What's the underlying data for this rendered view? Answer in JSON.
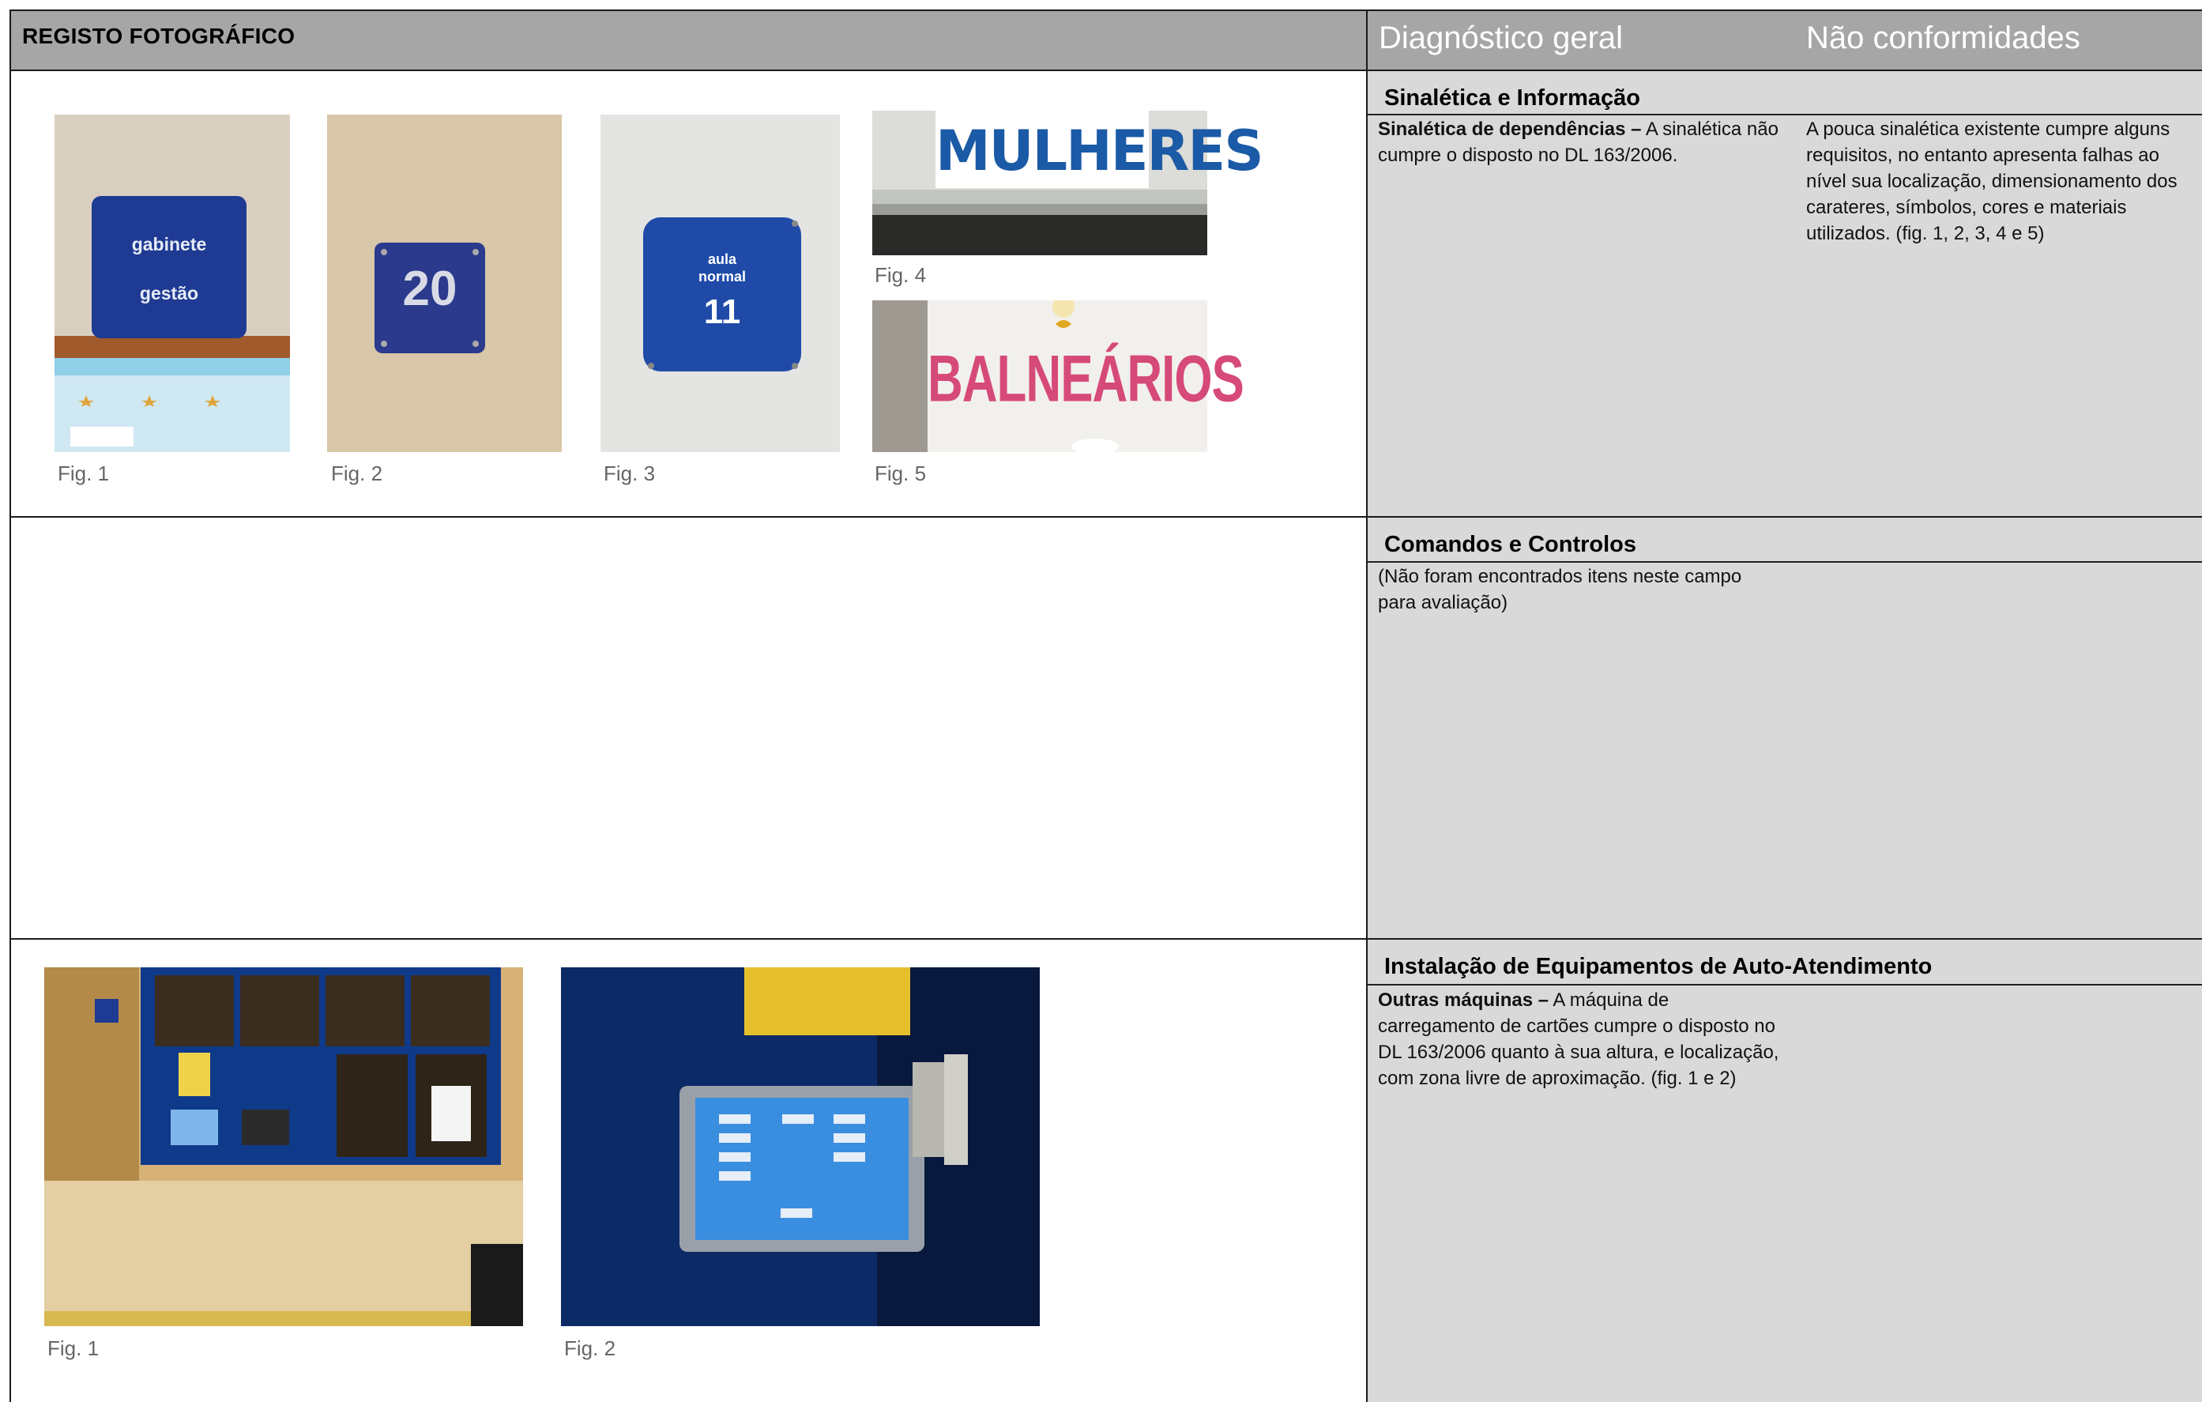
{
  "header": {
    "title": "REGISTO FOTOGRÁFICO",
    "col_diagnostico": "Diagnóstico geral",
    "col_nao_conformidades": "Não conformidades"
  },
  "sections": [
    {
      "title": "Sinalética e Informação",
      "diagnostico_bold": "Sinalética de dependências –",
      "diagnostico_text": " A sinalética não cumpre o disposto no DL 163/2006.",
      "nao_conformidades": "A pouca sinalética existente cumpre alguns requisitos, no entanto apresenta falhas ao nível sua localização, dimensionamento dos carateres, símbolos, cores e materiais utilizados. (fig. 1, 2, 3, 4 e 5)",
      "figures": [
        {
          "caption": "Fig. 1",
          "sign_line1": "gabinete",
          "sign_line2": "gestão"
        },
        {
          "caption": "Fig. 2",
          "sign_number": "20"
        },
        {
          "caption": "Fig. 3",
          "sign_line1": "aula",
          "sign_line2": "normal",
          "sign_number": "11"
        },
        {
          "caption": "Fig. 4",
          "sign_text": "MULHERES"
        },
        {
          "caption": "Fig. 5",
          "sign_text": "BALNEÁRIOS"
        }
      ]
    },
    {
      "title": "Comandos e Controlos",
      "diagnostico_text": "(Não foram encontrados itens neste campo para avaliação)",
      "nao_conformidades": ""
    },
    {
      "title": "Instalação de Equipamentos de Auto-Atendimento",
      "diagnostico_bold": "Outras máquinas –",
      "diagnostico_text": " A máquina de carregamento de cartões cumpre o disposto no DL 163/2006 quanto à sua altura, e localização, com zona livre de aproximação. (fig. 1 e 2)",
      "nao_conformidades": "",
      "figures": [
        {
          "caption": "Fig. 1"
        },
        {
          "caption": "Fig. 2"
        }
      ]
    }
  ],
  "colors": {
    "header_bg": "#a6a6a6",
    "panel_bg": "#d9d9d9",
    "sign_blue": "#1f3a93",
    "caption_gray": "#666666"
  }
}
